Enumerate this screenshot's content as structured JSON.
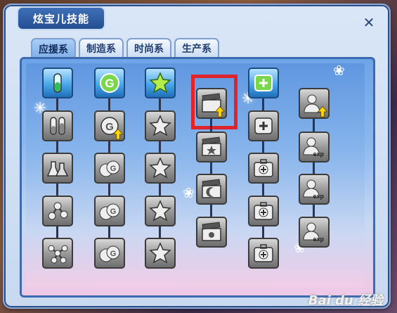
{
  "window": {
    "title": "炫宝儿技能",
    "close_label": "✕"
  },
  "tabs": [
    {
      "label": "应援系",
      "active": true
    },
    {
      "label": "制造系",
      "active": false
    },
    {
      "label": "时尚系",
      "active": false
    },
    {
      "label": "生产系",
      "active": false
    }
  ],
  "columns": [
    {
      "skills": [
        "test-tube-icon-active",
        "test-tubes-icon",
        "flasks-icon",
        "molecule-small-icon",
        "molecule-large-icon"
      ]
    },
    {
      "skills": [
        "g-coin-icon-active",
        "g-coin-upgrade-icon",
        "g-coins-2-icon",
        "g-coins-3-icon",
        "g-coins-4-icon"
      ]
    },
    {
      "skills": [
        "star-badge-icon-active",
        "star-badge-icon",
        "star-badge-icon",
        "star-badge-icon",
        "star-badge-icon"
      ]
    },
    {
      "skills": [
        "clapper-upgrade-icon",
        "clapper-star-icon",
        "clapper-moon-icon",
        "clapper-sun-icon"
      ]
    },
    {
      "skills": [
        "medkit-icon-active",
        "plus-box-icon",
        "medkit-icon",
        "medkit-icon",
        "medkit-icon"
      ]
    },
    {
      "skills": [
        "person-upgrade-icon",
        "person-exp-icon",
        "person-exp-icon",
        "person-exp-icon"
      ]
    }
  ],
  "exp_label": "exp",
  "watermark": "Bai du 经验",
  "colors": {
    "highlight": "#e0242b",
    "title_bg": "#244e92"
  }
}
